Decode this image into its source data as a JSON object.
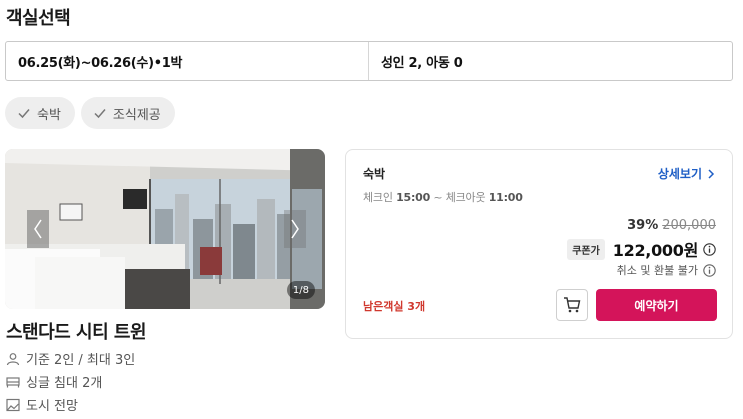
{
  "page": {
    "title": "객실선택"
  },
  "search": {
    "dates": "06.25(화)~06.26(수)•1박",
    "guests": "성인 2, 아동 0"
  },
  "filters": [
    {
      "label": "숙박",
      "icon": "check-icon"
    },
    {
      "label": "조식제공",
      "icon": "check-icon"
    }
  ],
  "room": {
    "photo_counter": "1/8",
    "name": "스탠다드 시티 트윈",
    "capacity": "기준 2인 / 최대 3인",
    "bed": "싱글 침대 2개",
    "view": "도시 전망"
  },
  "offer": {
    "type": "숙박",
    "detail_link": "상세보기",
    "checkin_label": "체크인",
    "checkin_time": "15:00",
    "separator": "~",
    "checkout_label": "체크아웃",
    "checkout_time": "11:00",
    "discount": "39%",
    "original_price": "200,000",
    "coupon_label": "쿠폰가",
    "price": "122,000원",
    "refund_policy": "취소 및 환불 불가",
    "remaining": "남은객실 3개",
    "reserve_button": "예약하기"
  },
  "colors": {
    "accent": "#d4145a",
    "link": "#1f5fc6",
    "warning": "#d0382e"
  }
}
